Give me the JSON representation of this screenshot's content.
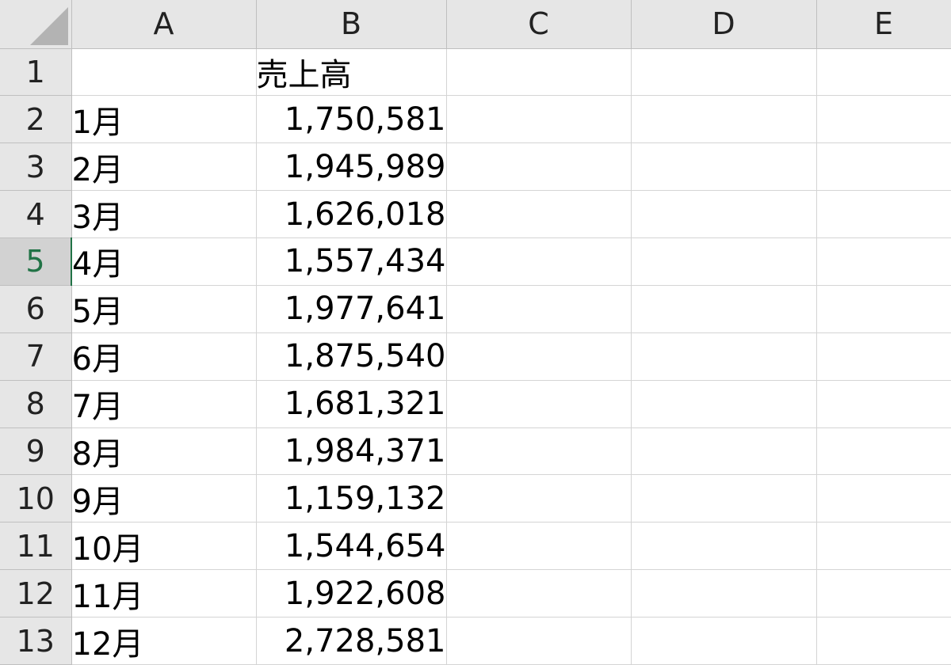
{
  "columns": [
    "A",
    "B",
    "C",
    "D",
    "E"
  ],
  "header_row": {
    "row_number": "1",
    "a": "",
    "b": "売上高"
  },
  "selected_row": "5",
  "rows": [
    {
      "row_number": "2",
      "month": "1月",
      "sales": "1,750,581"
    },
    {
      "row_number": "3",
      "month": "2月",
      "sales": "1,945,989"
    },
    {
      "row_number": "4",
      "month": "3月",
      "sales": "1,626,018"
    },
    {
      "row_number": "5",
      "month": "4月",
      "sales": "1,557,434"
    },
    {
      "row_number": "6",
      "month": "5月",
      "sales": "1,977,641"
    },
    {
      "row_number": "7",
      "month": "6月",
      "sales": "1,875,540"
    },
    {
      "row_number": "8",
      "month": "7月",
      "sales": "1,681,321"
    },
    {
      "row_number": "9",
      "month": "8月",
      "sales": "1,984,371"
    },
    {
      "row_number": "10",
      "month": "9月",
      "sales": "1,159,132"
    },
    {
      "row_number": "11",
      "month": "10月",
      "sales": "1,544,654"
    },
    {
      "row_number": "12",
      "month": "11月",
      "sales": "1,922,608"
    },
    {
      "row_number": "13",
      "month": "12月",
      "sales": "2,728,581"
    }
  ],
  "colors": {
    "header_bg": "#e6e6e6",
    "selected_header_bg": "#d2d2d2",
    "selected_accent": "#217346",
    "gridline": "#d4d4d4"
  }
}
